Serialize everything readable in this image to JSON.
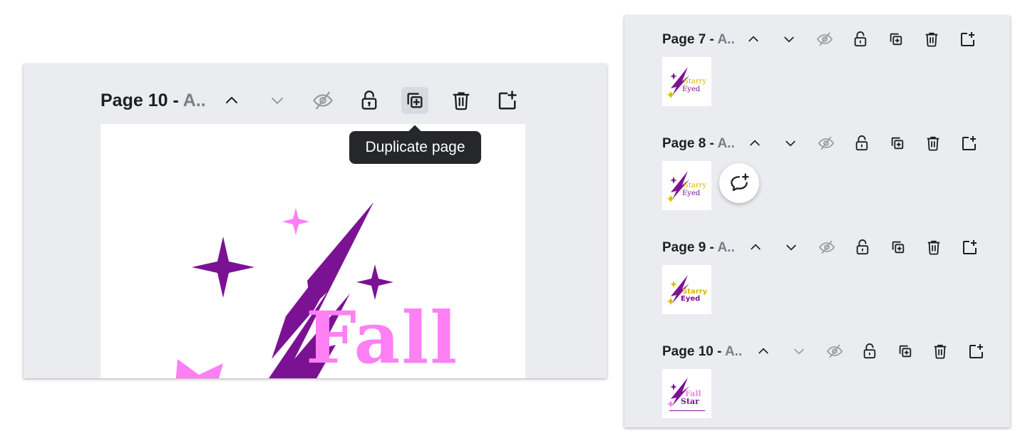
{
  "main_view": {
    "page_label": "Page 10 - ",
    "page_name": "A..",
    "tooltip": "Duplicate page",
    "canvas": {
      "word": "Fall",
      "colors": {
        "purple": "#7b1294",
        "pink": "#ff7ff5"
      }
    },
    "toolbar": [
      "move-up-icon",
      "move-down-icon",
      "hide-icon",
      "unlock-icon",
      "duplicate-page-icon",
      "delete-icon",
      "add-page-icon"
    ]
  },
  "page_list": [
    {
      "label": "Page 7 - ",
      "name": "A..",
      "thumb_line1": "Starry",
      "thumb_line2": "Eyed"
    },
    {
      "label": "Page 8 - ",
      "name": "A..",
      "thumb_line1": "Starry",
      "thumb_line2": "Eyed"
    },
    {
      "label": "Page 9 - ",
      "name": "A..",
      "thumb_line1": "Starry",
      "thumb_line2": "Eyed"
    },
    {
      "label": "Page 10 - ",
      "name": "A..",
      "thumb_line1": "Fall",
      "thumb_line2": "Star"
    }
  ],
  "comment_button": {
    "icon": "add-comment-icon"
  },
  "colors": {
    "panel_bg": "#ebecf0",
    "tooltip_bg": "#26272b",
    "text": "#1e1f23",
    "muted": "#7b7e87"
  }
}
